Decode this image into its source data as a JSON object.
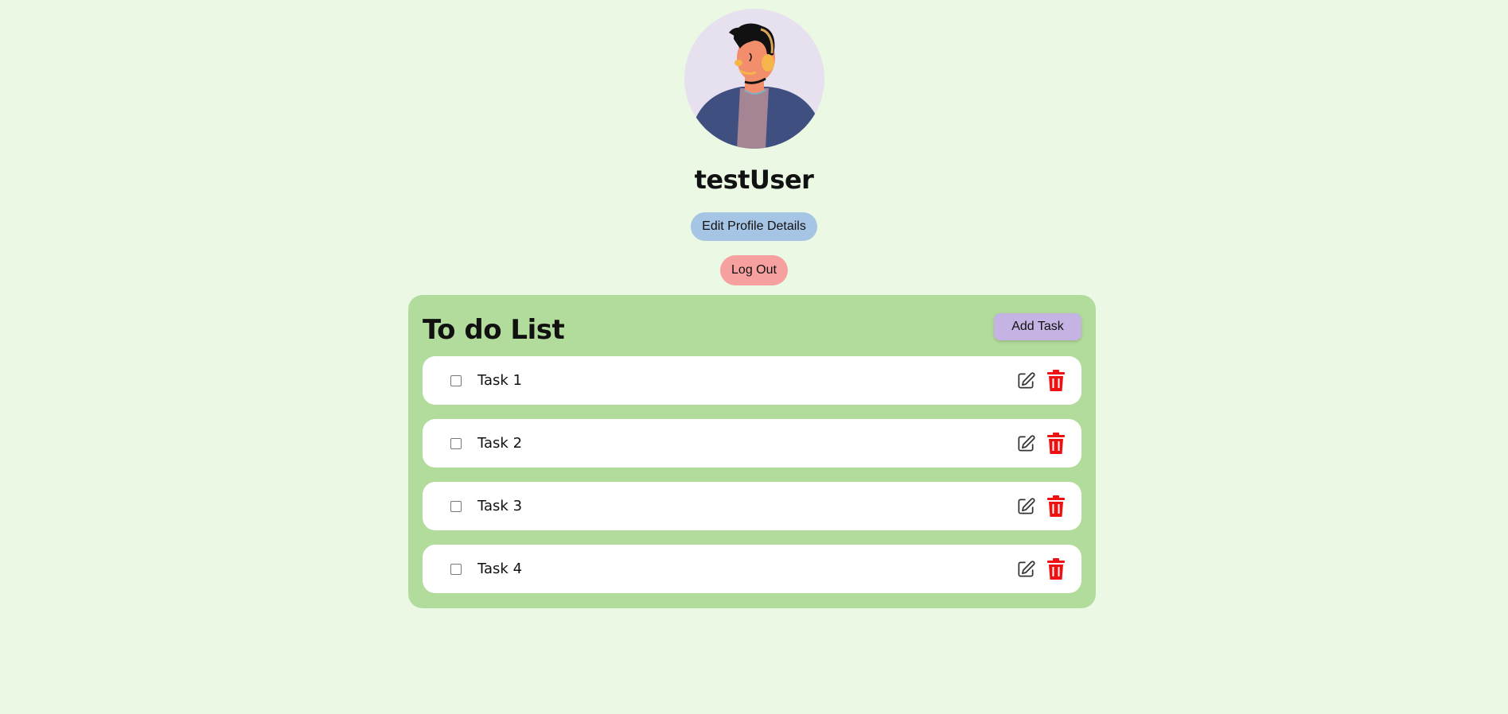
{
  "profile": {
    "username": "testUser",
    "edit_label": "Edit Profile Details",
    "logout_label": "Log Out"
  },
  "todo": {
    "title": "To do List",
    "add_label": "Add Task",
    "tasks": [
      {
        "label": "Task 1",
        "checked": false
      },
      {
        "label": "Task 2",
        "checked": false
      },
      {
        "label": "Task 3",
        "checked": false
      },
      {
        "label": "Task 4",
        "checked": false
      }
    ]
  },
  "icons": {
    "edit": "pencil-square-icon",
    "delete": "trash-icon"
  },
  "colors": {
    "page_bg": "#ebf8e4",
    "panel_bg": "#b2dc9c",
    "edit_button": "#a6c4e4",
    "logout_button": "#f6a0a0",
    "add_button": "#c5b3e3",
    "delete_icon": "#ee1111"
  }
}
